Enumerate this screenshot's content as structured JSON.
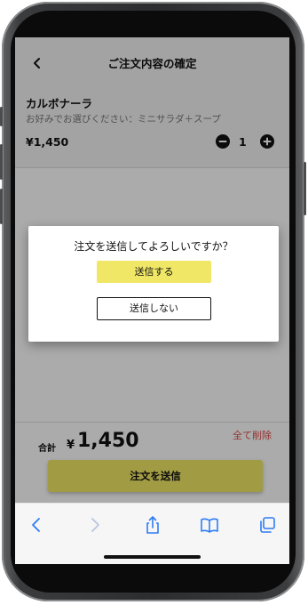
{
  "header": {
    "title": "ご注文内容の確定"
  },
  "order_item": {
    "name": "カルボナーラ",
    "option": "お好みでお選びください：ミニサラダ＋スープ",
    "price": "¥1,450",
    "quantity": "1"
  },
  "footer": {
    "total_label": "合計",
    "currency": "¥",
    "total": "1,450",
    "clear_all": "全て削除",
    "submit_label": "注文を送信"
  },
  "dialog": {
    "message": "注文を送信してよろしいですか？",
    "confirm_label": "送信する",
    "cancel_label": "送信しない"
  },
  "browser_toolbar": {
    "icons": [
      "back-icon",
      "forward-icon",
      "share-icon",
      "bookmarks-icon",
      "tabs-icon"
    ]
  },
  "colors": {
    "accent_yellow": "#f0e766",
    "danger_red": "#e04a4a",
    "overlay": "rgba(0,0,0,0.33)"
  }
}
